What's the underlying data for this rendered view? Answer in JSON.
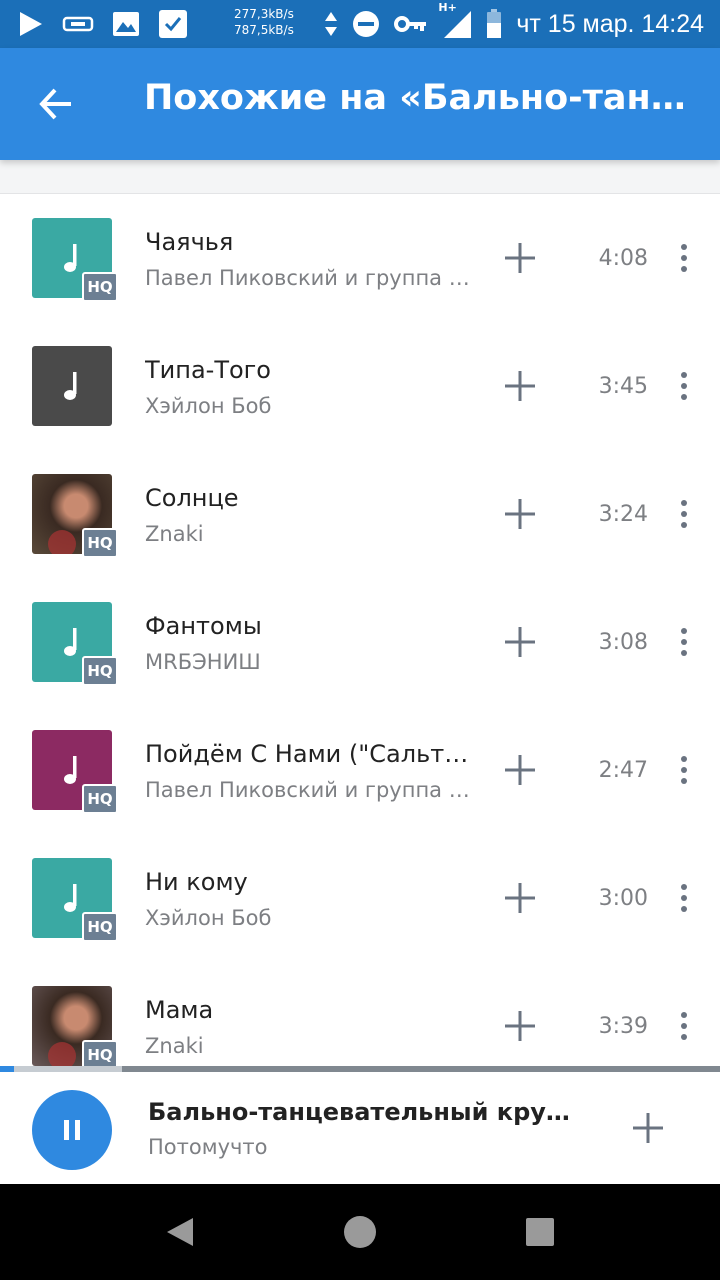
{
  "status_bar": {
    "speed_up": "277,3kB/s",
    "speed_down": "787,5kB/s",
    "network": "H+",
    "datetime": "чт 15 мар. 14:24"
  },
  "app_bar": {
    "title": "Похожие на «Бально-танцевательный кружок»"
  },
  "tracks": [
    {
      "title": "Чаячья",
      "artist": "Павел Пиковский и группа Хьюго",
      "duration": "4:08",
      "hq": "HQ",
      "cover_color": "#3aa9a3",
      "cover": "note"
    },
    {
      "title": "Типа-Того",
      "artist": "Хэйлон Боб",
      "duration": "3:45",
      "hq": "",
      "cover_color": "#4a4a4a",
      "cover": "note"
    },
    {
      "title": "Солнце",
      "artist": "Znaki",
      "duration": "3:24",
      "hq": "HQ",
      "cover_color": "#5a4a3a",
      "cover": "photo"
    },
    {
      "title": "Фантомы",
      "artist": "MRБЭНИШ",
      "duration": "3:08",
      "hq": "HQ",
      "cover_color": "#3aa9a3",
      "cover": "note"
    },
    {
      "title": "Пойдём С Нами (\"Сальто Назад\")",
      "artist": "Павел Пиковский и группа Хьюго",
      "duration": "2:47",
      "hq": "HQ",
      "cover_color": "#8c2a62",
      "cover": "note"
    },
    {
      "title": "Ни кому",
      "artist": "Хэйлон Боб",
      "duration": "3:00",
      "hq": "HQ",
      "cover_color": "#3aa9a3",
      "cover": "note"
    },
    {
      "title": "Мама",
      "artist": "Znaki",
      "duration": "3:39",
      "hq": "HQ",
      "cover_color": "#6a5a5a",
      "cover": "photo"
    }
  ],
  "player": {
    "title": "Бально-танцевательный кружок",
    "artist": "Потомучто",
    "progress": 0.02,
    "buffered": 0.17
  },
  "colors": {
    "accent": "#2f89e0",
    "status_bar": "#1b6fb8"
  }
}
